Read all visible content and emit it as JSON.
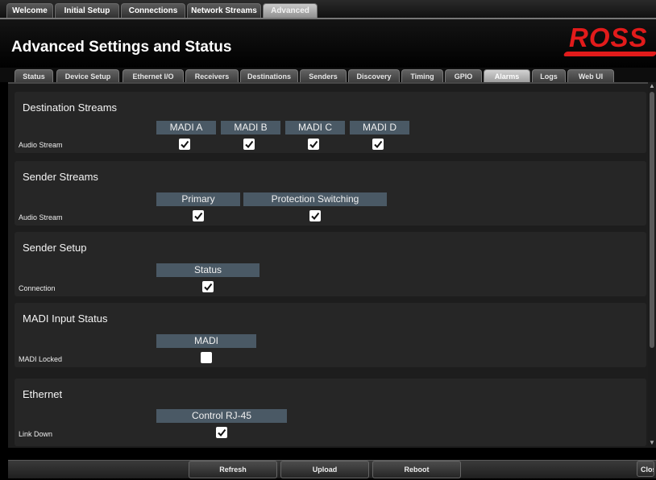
{
  "top_tabs": [
    "Welcome",
    "Initial Setup",
    "Connections",
    "Network Streams",
    "Advanced"
  ],
  "active_top_tab": "Advanced",
  "title": "Advanced Settings and Status",
  "logo": "ROSS",
  "sub_tabs": [
    "Status",
    "Device Setup",
    "Ethernet I/O",
    "Receivers",
    "Destinations",
    "Senders",
    "Discovery",
    "Timing",
    "GPIO",
    "Alarms",
    "Logs",
    "Web UI"
  ],
  "active_sub_tab": "Alarms",
  "sections": [
    {
      "title": "Destination Streams",
      "columns": [
        "MADI A",
        "MADI B",
        "MADI C",
        "MADI D"
      ],
      "row_label": "Audio Stream",
      "checked": [
        true,
        true,
        true,
        true
      ]
    },
    {
      "title": "Sender Streams",
      "columns": [
        "Primary",
        "Protection Switching"
      ],
      "row_label": "Audio Stream",
      "checked": [
        true,
        true
      ]
    },
    {
      "title": "Sender Setup",
      "columns": [
        "Status"
      ],
      "row_label": "Connection",
      "checked": [
        true
      ]
    },
    {
      "title": "MADI Input Status",
      "columns": [
        "MADI"
      ],
      "row_label": "MADI Locked",
      "checked": [
        false
      ]
    },
    {
      "title": "Ethernet",
      "columns": [
        "Control RJ-45"
      ],
      "row_label": "Link Down",
      "checked": [
        true
      ]
    }
  ],
  "buttons": {
    "refresh": "Refresh",
    "upload": "Upload",
    "reboot": "Reboot",
    "close": "Close"
  }
}
